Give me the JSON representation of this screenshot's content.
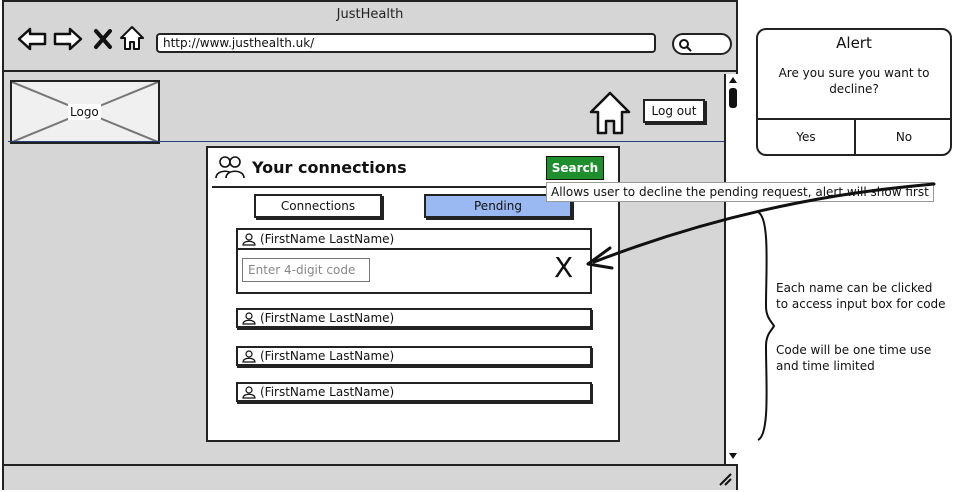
{
  "window": {
    "title": "JustHealth",
    "url": "http://www.justhealth.uk/"
  },
  "header": {
    "logo_label": "Logo",
    "logout_label": "Log out"
  },
  "panel": {
    "title": "Your connections",
    "search_label": "Search",
    "tabs": [
      {
        "label": "Connections",
        "active": false
      },
      {
        "label": "Pending",
        "active": true
      }
    ],
    "expanded_row": {
      "name": "(FirstName LastName)",
      "code_placeholder": "Enter 4-digit code",
      "decline_glyph": "X"
    },
    "rows": [
      {
        "name": "(FirstName LastName)"
      },
      {
        "name": "(FirstName LastName)"
      },
      {
        "name": "(FirstName LastName)"
      }
    ]
  },
  "annotations": {
    "decline_tooltip": "Allows user to decline the pending request, alert will show first",
    "note_1": "Each name can be clicked to access input box for code",
    "note_2": "Code will be one time use and time limited"
  },
  "alert": {
    "title": "Alert",
    "message": "Are you sure you want to decline?",
    "yes_label": "Yes",
    "no_label": "No"
  },
  "icons": {
    "back": "back-arrow-icon",
    "forward": "forward-arrow-icon",
    "stop": "close-icon",
    "home": "home-icon",
    "search": "search-icon",
    "people": "people-icon",
    "user": "user-icon"
  },
  "colors": {
    "search_button": "#1f8f2e",
    "pending_tab": "#9ab8f2",
    "header_divider": "#2a3e7a"
  }
}
